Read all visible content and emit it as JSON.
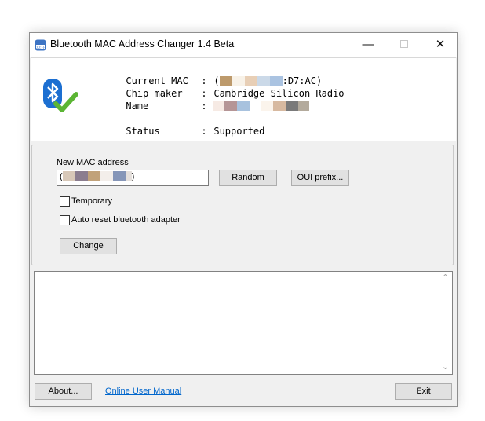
{
  "window": {
    "title": "Bluetooth MAC Address Changer 1.4 Beta",
    "minimize_glyph": "—",
    "close_glyph": "✕",
    "app_icon": "bluetooth-changer-app-icon"
  },
  "info": {
    "logo_icon": "bluetooth-check-icon",
    "current_mac_label": "Current MAC",
    "current_mac_prefix": "(",
    "current_mac_suffix": ":D7:AC)",
    "chip_maker_label": "Chip maker",
    "chip_maker_value": "Cambridge Silicon Radio",
    "name_label": "Name",
    "status_label": "Status",
    "status_value": "Supported",
    "separator": ":"
  },
  "form": {
    "new_mac_label": "New MAC address",
    "mac_input_prefix": "(",
    "mac_input_suffix": ")",
    "random_label": "Random",
    "oui_label": "OUI prefix...",
    "temporary_label": "Temporary",
    "temporary_checked": false,
    "auto_reset_label": "Auto reset bluetooth adapter",
    "auto_reset_checked": false,
    "change_label": "Change"
  },
  "log": {
    "scroll_up_glyph": "⌃",
    "scroll_down_glyph": "⌄"
  },
  "footer": {
    "about_label": "About...",
    "manual_link": "Online User Manual",
    "exit_label": "Exit"
  },
  "colors": {
    "link": "#0066cc",
    "bluetooth_blue": "#1c6fd1",
    "check_green": "#5bb534"
  }
}
